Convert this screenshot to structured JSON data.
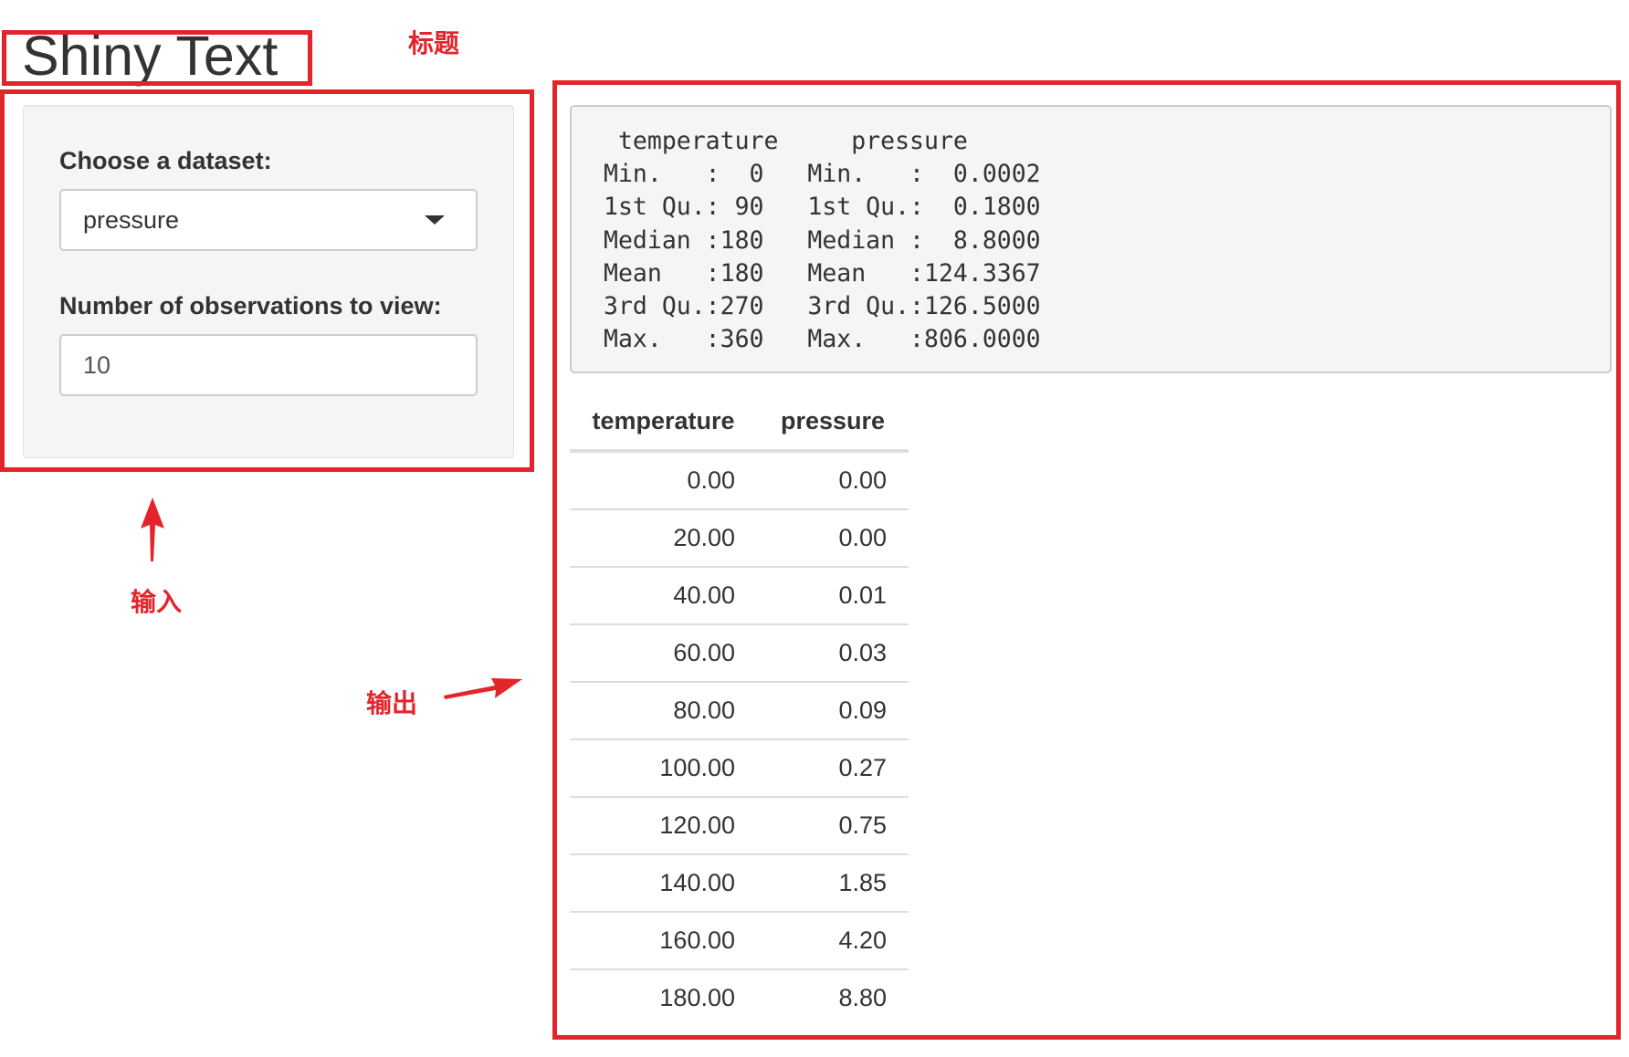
{
  "app": {
    "title": "Shiny Text"
  },
  "sidebar": {
    "dataset_label": "Choose a dataset:",
    "dataset_selected": "pressure",
    "observations_label": "Number of observations to view:",
    "observations_value": "10"
  },
  "summary": {
    "lines": [
      " temperature     pressure",
      "Min.   :  0   Min.   :  0.0002",
      "1st Qu.: 90   1st Qu.:  0.1800",
      "Median :180   Median :  8.8000",
      "Mean   :180   Mean   :124.3367",
      "3rd Qu.:270   3rd Qu.:126.5000",
      "Max.   :360   Max.   :806.0000"
    ]
  },
  "table": {
    "headers": [
      "temperature",
      "pressure"
    ],
    "rows": [
      [
        "0.00",
        "0.00"
      ],
      [
        "20.00",
        "0.00"
      ],
      [
        "40.00",
        "0.01"
      ],
      [
        "60.00",
        "0.03"
      ],
      [
        "80.00",
        "0.09"
      ],
      [
        "100.00",
        "0.27"
      ],
      [
        "120.00",
        "0.75"
      ],
      [
        "140.00",
        "1.85"
      ],
      [
        "160.00",
        "4.20"
      ],
      [
        "180.00",
        "8.80"
      ]
    ]
  },
  "annotations": {
    "title_label": "标题",
    "input_label": "输入",
    "output_label": "输出",
    "color": "#e3242b"
  },
  "icons": {
    "dropdown": "caret-down-icon"
  }
}
